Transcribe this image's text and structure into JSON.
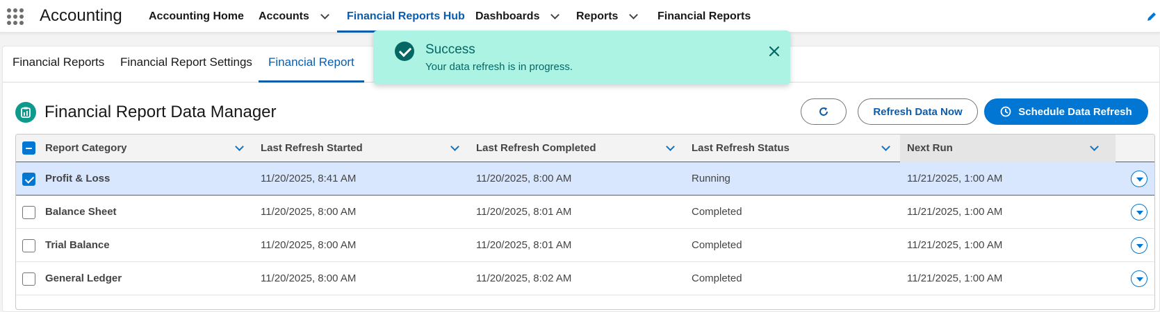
{
  "app": {
    "name": "Accounting"
  },
  "nav": {
    "items": [
      {
        "label": "Accounting Home",
        "has_menu": false
      },
      {
        "label": "Accounts",
        "has_menu": true
      },
      {
        "label": "Financial Reports Hub",
        "has_menu": false,
        "active": true
      },
      {
        "label": "Dashboards",
        "has_menu": true
      },
      {
        "label": "Reports",
        "has_menu": true
      },
      {
        "label": "Financial Reports",
        "has_menu": false
      }
    ]
  },
  "subtabs": [
    {
      "label": "Financial Reports"
    },
    {
      "label": "Financial Report Settings"
    },
    {
      "label": "Financial Report",
      "active": true
    }
  ],
  "page": {
    "title": "Financial Report Data Manager",
    "icon": "report-icon"
  },
  "actions": {
    "refresh_icon": "refresh-icon",
    "refresh_now": "Refresh Data Now",
    "schedule": "Schedule Data Refresh"
  },
  "table": {
    "columns": [
      "Report Category",
      "Last Refresh Started",
      "Last Refresh Completed",
      "Last Refresh Status",
      "Next Run"
    ],
    "rows": [
      {
        "category": "Profit & Loss",
        "started": "11/20/2025, 8:41 AM",
        "completed": "11/20/2025, 8:00 AM",
        "status": "Running",
        "next_run": "11/21/2025, 1:00 AM",
        "selected": true
      },
      {
        "category": "Balance Sheet",
        "started": "11/20/2025, 8:00 AM",
        "completed": "11/20/2025, 8:01 AM",
        "status": "Completed",
        "next_run": "11/21/2025, 1:00 AM",
        "selected": false
      },
      {
        "category": "Trial Balance",
        "started": "11/20/2025, 8:00 AM",
        "completed": "11/20/2025, 8:01 AM",
        "status": "Completed",
        "next_run": "11/21/2025, 1:00 AM",
        "selected": false
      },
      {
        "category": "General Ledger",
        "started": "11/20/2025, 8:00 AM",
        "completed": "11/20/2025, 8:02 AM",
        "status": "Completed",
        "next_run": "11/21/2025, 1:00 AM",
        "selected": false
      }
    ]
  },
  "toast": {
    "title": "Success",
    "message": "Your data refresh is in progress.",
    "variant": "success"
  },
  "colors": {
    "brand": "#0176d3",
    "link": "#0b5cab",
    "toast_bg": "#acf3e4",
    "toast_text": "#056764",
    "header_icon": "#0d9a8d",
    "selected_row": "#d8e6fe"
  }
}
